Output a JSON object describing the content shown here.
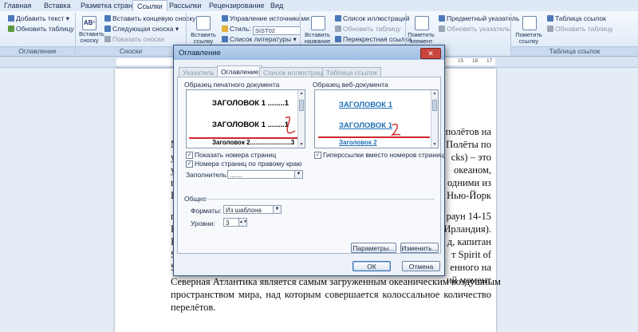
{
  "ribbon": {
    "tabs": [
      "Главная",
      "Вставка",
      "Разметка страницы",
      "Ссылки",
      "Рассылки",
      "Рецензирование",
      "Вид"
    ],
    "active_tab": "Ссылки",
    "toc_group": {
      "add_text": "Добавить текст",
      "update_table": "Обновить таблицу",
      "label": "Оглавление"
    },
    "footnotes_group": {
      "insert_footnote": "Вставить сноску",
      "insert_endnote": "Вставить концевую сноску",
      "next_footnote": "Следующая сноска",
      "show_notes": "Показать сноски",
      "label": "Сноски"
    },
    "citations_group": {
      "insert_citation": "Вставить ссылку",
      "manage_sources": "Управление источниками",
      "style_label": "Стиль:",
      "style_value": "SIST02",
      "bibliography": "Список литературы"
    },
    "captions_group": {
      "insert_caption": "Вставить название",
      "table_of_figures": "Список иллюстраций",
      "update_table": "Обновить таблицу",
      "cross_reference": "Перекрестная ссылка"
    },
    "index_group": {
      "mark_entry": "Пометить элемент",
      "insert_index": "Предметный указатель",
      "update_index": "Обновить указатель"
    },
    "toa_group": {
      "mark_citation": "Пометить ссылку",
      "insert_toa": "Таблица ссылок",
      "update_table": "Обновить таблицу",
      "label": "Таблица ссылок"
    }
  },
  "ruler": {
    "numbers": [
      "1",
      "2",
      "3",
      "4",
      "5",
      "6",
      "7",
      "8",
      "9",
      "10",
      "11",
      "12",
      "13",
      "14",
      "15",
      "16",
      "17"
    ]
  },
  "document": {
    "lines": [
      {
        "text": "полётов на",
        "left": "right"
      },
      {
        "text": "Полёты по",
        "left": "right"
      },
      {
        "text": "cks) – это",
        "left": "right"
      },
      {
        "text": "океаном,",
        "left": "right"
      },
      {
        "text": "одними из",
        "left": "right"
      },
      {
        "text": "Нью-Йорк",
        "left": "right"
      },
      {
        "text": "раун 14-15",
        "left": "right"
      },
      {
        "text": "Ирландия).",
        "left": "right"
      },
      {
        "text": "д, капитан",
        "left": "right"
      },
      {
        "text": "т Spirit of",
        "left": "right"
      },
      {
        "text": "енного на",
        "left": "right"
      },
      {
        "text": "ий момент",
        "left": "right"
      }
    ],
    "bottom_lines": [
      "Северная Атлантика является самым загруженным океаническим воздушным",
      "пространством мира, над которым совершается колоссальное количество",
      "перелётов."
    ],
    "left_fragments": [
      "M",
      "y",
      "y",
      "п",
      "П",
      "п",
      "P",
      "R",
      "S",
      "S"
    ]
  },
  "dialog": {
    "title": "Оглавление",
    "close": "✕",
    "tabs": [
      "Указатель",
      "Оглавление",
      "Список иллюстраций",
      "Таблица ссылок"
    ],
    "active_tab": "Оглавление",
    "print_preview_label": "Образец печатного документа",
    "web_preview_label": "Образец веб-документа",
    "print_entries": [
      {
        "text": "ЗАГОЛОВОК 1 ........",
        "page": "1"
      },
      {
        "text": "ЗАГОЛОВОК 1 ........",
        "page": "1"
      },
      {
        "text": "Заголовок 2.......................",
        "page": "3"
      }
    ],
    "web_entries": [
      "ЗАГОЛОВОК 1",
      "ЗАГОЛОВОК 1",
      "Заголовок 2"
    ],
    "show_page_numbers": "Показать номера страниц",
    "right_align": "Номера страниц по правому краю",
    "hyperlinks": "Гиперссылки вместо номеров страниц",
    "tab_leader_label": "Заполнитель:",
    "tab_leader_value": ".......",
    "general_label": "Общие",
    "formats_label": "Форматы:",
    "formats_value": "Из шаблона",
    "levels_label": "Уровни:",
    "levels_value": "3",
    "options_button": "Параметры...",
    "modify_button": "Изменить...",
    "ok_button": "ОК",
    "cancel_button": "Отмена",
    "check_mark": "✓",
    "annotation_color": "#d0262a"
  }
}
